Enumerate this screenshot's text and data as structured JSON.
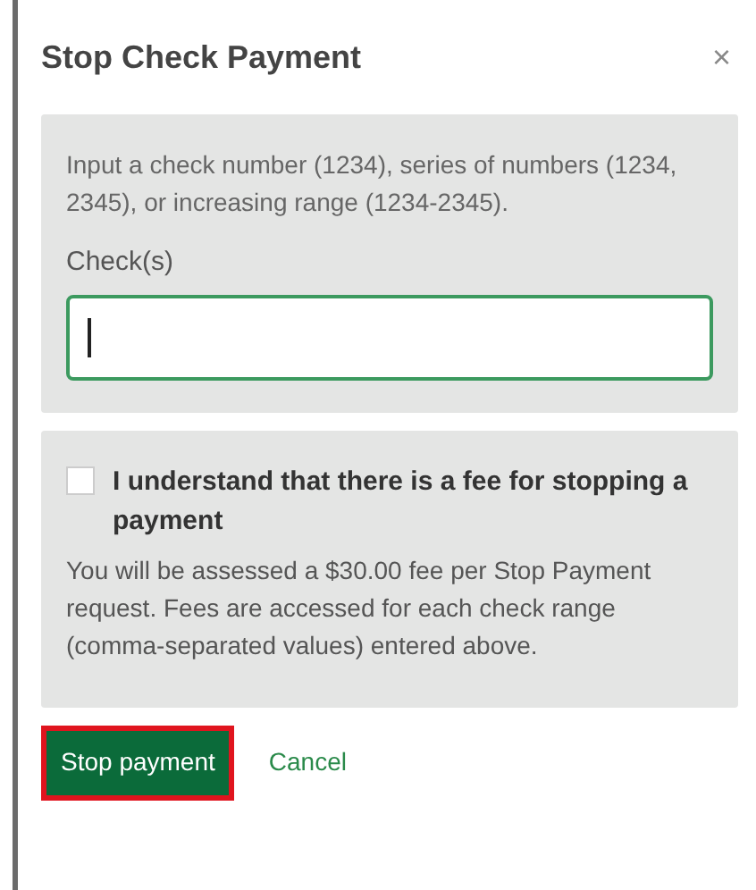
{
  "dialog": {
    "title": "Stop Check Payment",
    "close": "×"
  },
  "checks_panel": {
    "instructions": "Input a check number (1234), series of numbers (1234, 2345), or increasing range (1234-2345).",
    "field_label": "Check(s)",
    "field_focused": true
  },
  "fee_panel": {
    "checkbox": {
      "label": "I understand that there is a fee for stopping a payment",
      "checked": false
    },
    "notice": "You will be assessed a $30.00 fee per Stop Payment request. Fees are accessed for each check range (comma-separated values) entered above."
  },
  "actions": [
    {
      "label": "Stop payment",
      "kind": "primary",
      "highlighted": true
    },
    {
      "label": "Cancel",
      "kind": "link",
      "highlighted": false
    }
  ]
}
